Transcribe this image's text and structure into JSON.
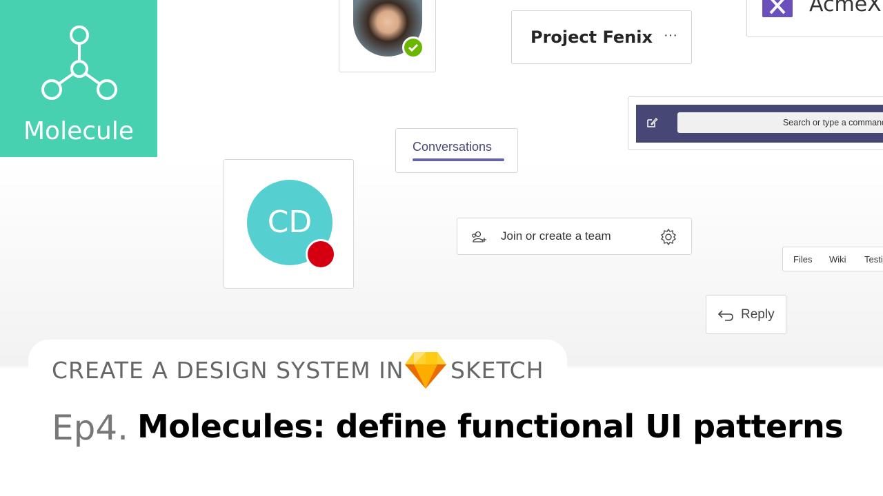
{
  "badge": {
    "label": "Molecule",
    "color": "#47d1b1"
  },
  "project": {
    "name": "Project Fenix",
    "more": "···"
  },
  "org": {
    "name": "AcmeX",
    "logo_color": "#6b4fbb"
  },
  "command_bar": {
    "placeholder": "Search or type a command",
    "bar_color": "#464775"
  },
  "conversations_tab": {
    "label": "Conversations",
    "accent": "#6264a7"
  },
  "avatar": {
    "initials": "CD",
    "status": "busy",
    "status_color": "#d40012",
    "bg": "#56cfd1"
  },
  "photo_avatar": {
    "status": "available",
    "status_color": "#6bb700"
  },
  "join_team": {
    "label": "Join or create a team"
  },
  "tabs": [
    "Files",
    "Wiki",
    "Testi"
  ],
  "reply": {
    "label": "Reply"
  },
  "series": {
    "left": "CREATE A DESIGN SYSTEM IN",
    "right": "SKETCH"
  },
  "episode": {
    "number": "Ep4.",
    "title": "Molecules: define functional UI patterns"
  }
}
